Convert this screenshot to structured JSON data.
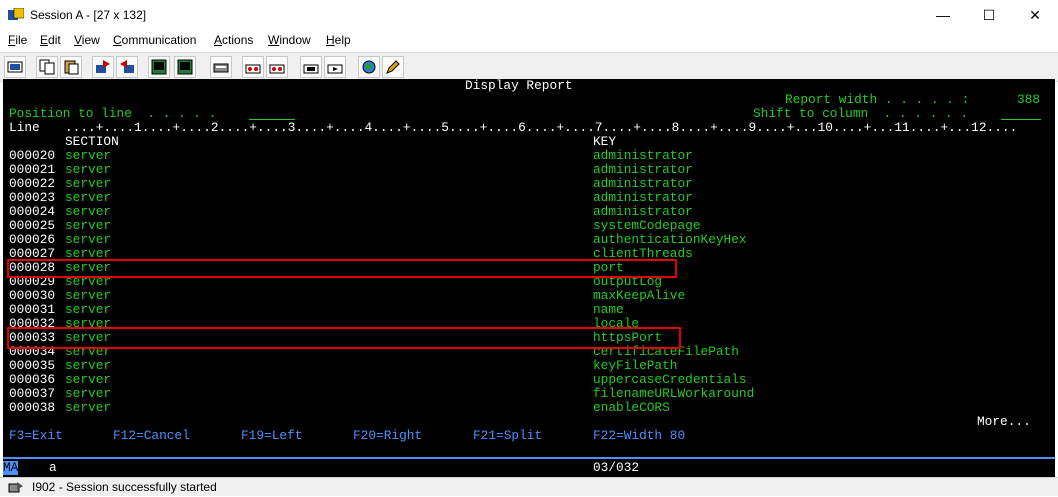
{
  "window": {
    "title": "Session A - [27 x 132]",
    "minimize": "—",
    "maximize": "☐",
    "close": "✕"
  },
  "menu": [
    "File",
    "Edit",
    "View",
    "Communication",
    "Actions",
    "Window",
    "Help"
  ],
  "menu_mnemonics": [
    "F",
    "E",
    "V",
    "C",
    "A",
    "W",
    "H"
  ],
  "toolbar": {
    "icons": [
      "print-screen-icon",
      "copy-icon",
      "paste-icon",
      "send-file-icon",
      "receive-file-icon",
      "display-icon",
      "display2-icon",
      "keyboard-icon",
      "macro-record-icon",
      "macro-play-icon",
      "macro-stop-icon",
      "macro-run-icon",
      "globe-icon",
      "edit-icon"
    ]
  },
  "screen": {
    "header_title": "Display Report",
    "position_label": "Position to line  . . . . .",
    "position_value": "_",
    "report_width_label": "Report width . . . . . :",
    "report_width_value": "388",
    "shift_label": "Shift to column  . . . . . .",
    "line_label": "Line",
    "ruler": "....+....1....+....2....+....3....+....4....+....5....+....6....+....7....+....8....+....9....+...10....+...11....+...12....",
    "col_section": "SECTION",
    "col_key": "KEY",
    "rows": [
      {
        "line": "000020",
        "section": "server",
        "key": "administrator"
      },
      {
        "line": "000021",
        "section": "server",
        "key": "administrator"
      },
      {
        "line": "000022",
        "section": "server",
        "key": "administrator"
      },
      {
        "line": "000023",
        "section": "server",
        "key": "administrator"
      },
      {
        "line": "000024",
        "section": "server",
        "key": "administrator"
      },
      {
        "line": "000025",
        "section": "server",
        "key": "systemCodepage"
      },
      {
        "line": "000026",
        "section": "server",
        "key": "authenticationKeyHex"
      },
      {
        "line": "000027",
        "section": "server",
        "key": "clientThreads"
      },
      {
        "line": "000028",
        "section": "server",
        "key": "port"
      },
      {
        "line": "000029",
        "section": "server",
        "key": "outputLog"
      },
      {
        "line": "000030",
        "section": "server",
        "key": "maxKeepAlive"
      },
      {
        "line": "000031",
        "section": "server",
        "key": "name"
      },
      {
        "line": "000032",
        "section": "server",
        "key": "locale"
      },
      {
        "line": "000033",
        "section": "server",
        "key": "httpsPort"
      },
      {
        "line": "000034",
        "section": "server",
        "key": "certificateFilePath"
      },
      {
        "line": "000035",
        "section": "server",
        "key": "keyFilePath"
      },
      {
        "line": "000036",
        "section": "server",
        "key": "uppercaseCredentials"
      },
      {
        "line": "000037",
        "section": "server",
        "key": "filenameURLWorkaround"
      },
      {
        "line": "000038",
        "section": "server",
        "key": "enableCORS"
      }
    ],
    "more": "More...",
    "fkeys": [
      "F3=Exit",
      "F12=Cancel",
      "F19=Left",
      "F20=Right",
      "F21=Split",
      "F22=Width 80"
    ]
  },
  "oia": {
    "mode": "MA",
    "indicator": "a",
    "cursor": "03/032"
  },
  "status": {
    "message": "I902 - Session successfully started"
  },
  "colors": {
    "terminal_bg": "#000000",
    "green": "#22cc22",
    "blue": "#4d8fff",
    "white": "#ffffff",
    "highlight": "#e00000"
  }
}
